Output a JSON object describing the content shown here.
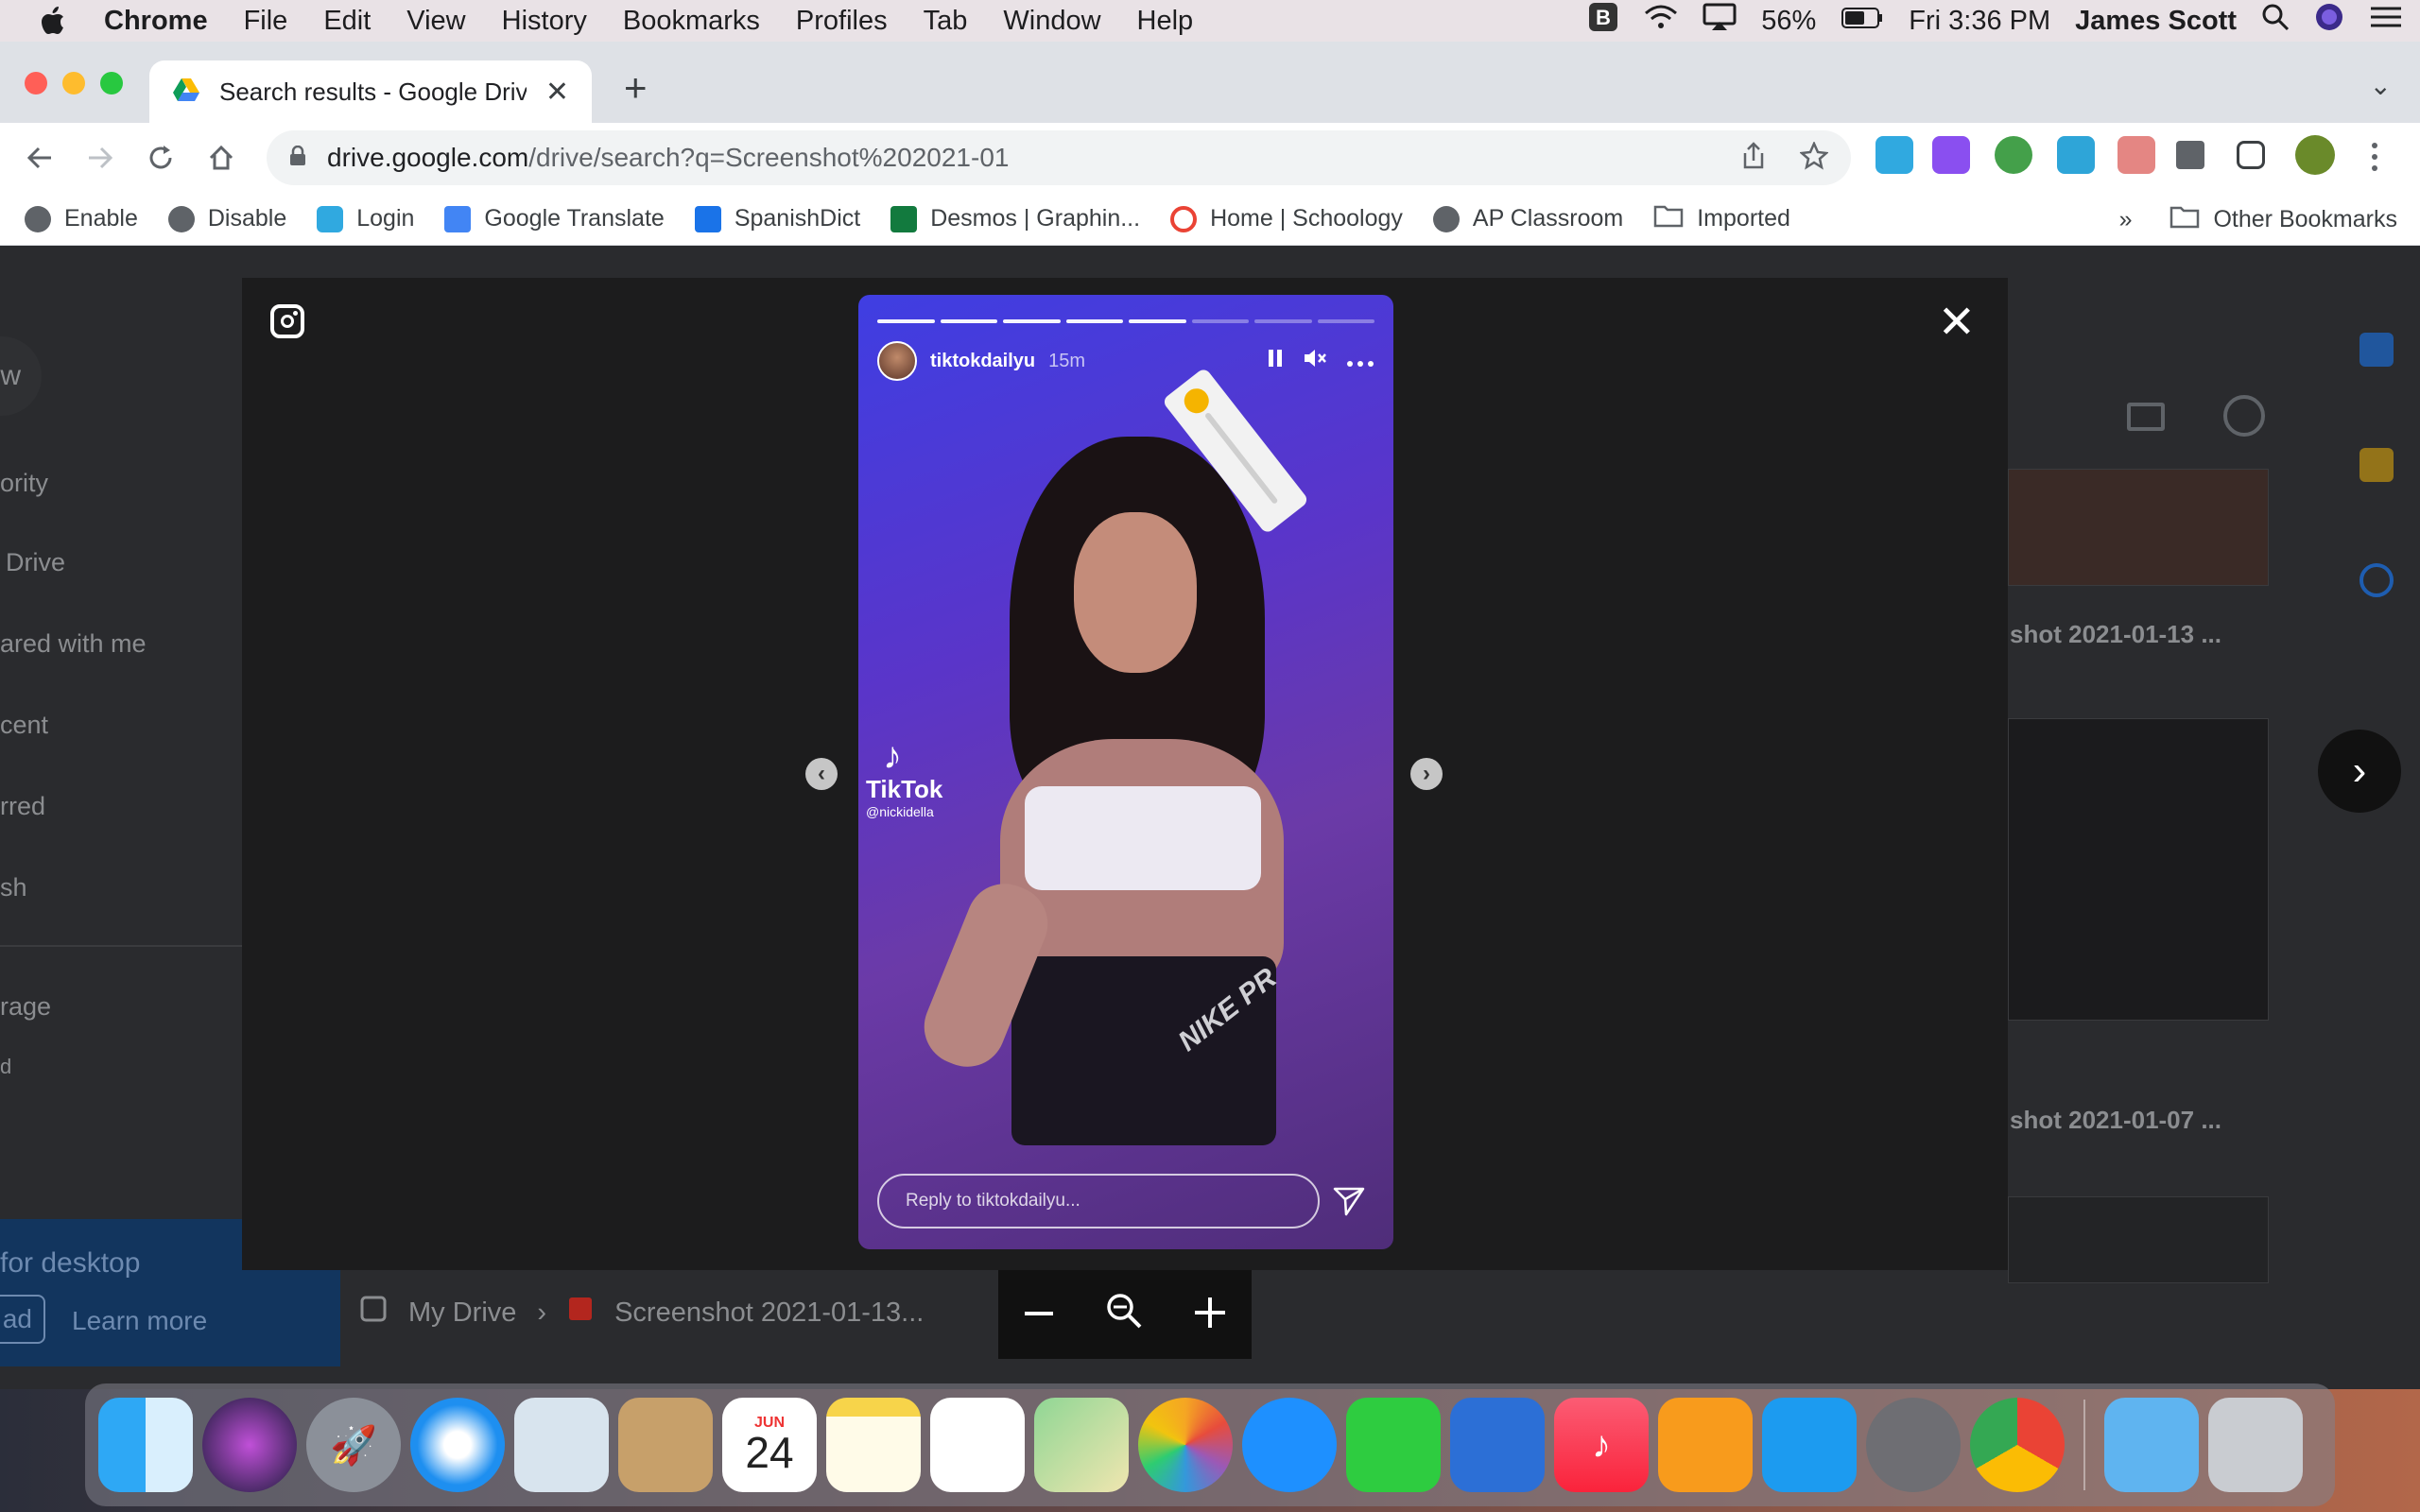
{
  "menubar": {
    "app": "Chrome",
    "items": [
      "File",
      "Edit",
      "View",
      "History",
      "Bookmarks",
      "Profiles",
      "Tab",
      "Window",
      "Help"
    ],
    "battery": "56%",
    "clock": "Fri 3:36 PM",
    "user": "James Scott"
  },
  "tab": {
    "title": "Search results - Google Drive"
  },
  "address": {
    "host": "drive.google.com",
    "path": "/drive/search?q=Screenshot%202021-01"
  },
  "bookmarks": {
    "items": [
      "Enable",
      "Disable",
      "Login",
      "Google Translate",
      "SpanishDict",
      "Desmos | Graphin...",
      "Home | Schoology",
      "AP Classroom",
      "Imported"
    ],
    "overflow": "»",
    "other": "Other Bookmarks"
  },
  "drive": {
    "sidebar": [
      "w",
      "ority",
      "Drive",
      "ared with me",
      "cent",
      "rred",
      "sh",
      "rage",
      "d"
    ],
    "files": [
      "shot 2021-01-13 ...",
      "shot 2021-01-07 ..."
    ],
    "promo_title": "for desktop",
    "promo_left": "ad",
    "promo_link": "Learn more",
    "breadcrumb_root": "My Drive",
    "breadcrumb_file": "Screenshot 2021-01-13..."
  },
  "story": {
    "username": "tiktokdailyu",
    "time": "15m",
    "progress_total": 8,
    "progress_done": 5,
    "tiktok_brand": "TikTok",
    "tiktok_handle": "@nickidella",
    "shorts_text": "NIKE PR",
    "reply_placeholder": "Reply to tiktokdailyu..."
  },
  "dock": {
    "calendar_month": "JUN",
    "calendar_day": "24"
  },
  "colors": {
    "menubar": "#e9e2e6",
    "tabstrip": "#dee1e6",
    "viewer": "#1c1c1d",
    "story_gradient_start": "#3f3ee2"
  }
}
